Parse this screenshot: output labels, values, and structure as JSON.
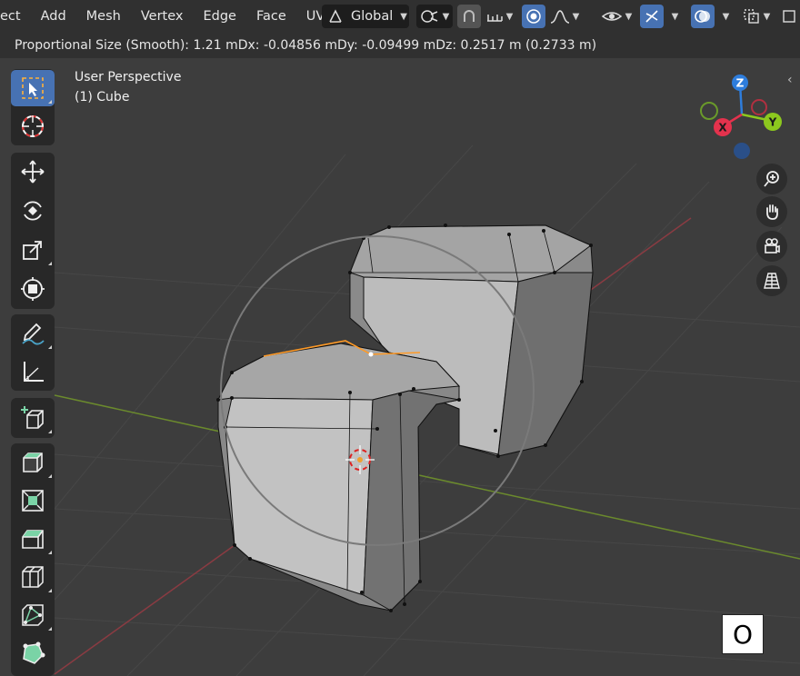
{
  "menu": {
    "items": [
      "ect",
      "Add",
      "Mesh",
      "Vertex",
      "Edge",
      "Face",
      "UV"
    ]
  },
  "header": {
    "transform_orientation": "Global",
    "icons": [
      "orientation-icon",
      "pivot-icon",
      "snap-icon",
      "snap-increment-icon",
      "proportional-edit-icon",
      "falloff-curve-icon",
      "visibility-icon",
      "gizmo-icon",
      "overlay-icon",
      "xray-icon"
    ]
  },
  "status": {
    "proportional": "Proportional Size (Smooth): 1.21 m",
    "dx": "Dx: -0.04856 m",
    "dy": "Dy: -0.09499 m",
    "dz": "Dz: 0.2517 m (0.2733 m)"
  },
  "viewport": {
    "view_name": "User Perspective",
    "object_name": "(1) Cube"
  },
  "gizmo": {
    "x_label": "X",
    "y_label": "Y",
    "z_label": "Z",
    "colors": {
      "x": "#e4324d",
      "y": "#8cc81e",
      "z": "#2e7ddc"
    }
  },
  "toolbar": {
    "tools": [
      "select-box",
      "cursor",
      "move",
      "rotate",
      "scale",
      "transform",
      "annotate",
      "measure",
      "add-cube",
      "extrude",
      "inset",
      "bevel",
      "loop-cut",
      "knife",
      "poly-build"
    ]
  },
  "key_overlay": {
    "key": "O"
  }
}
